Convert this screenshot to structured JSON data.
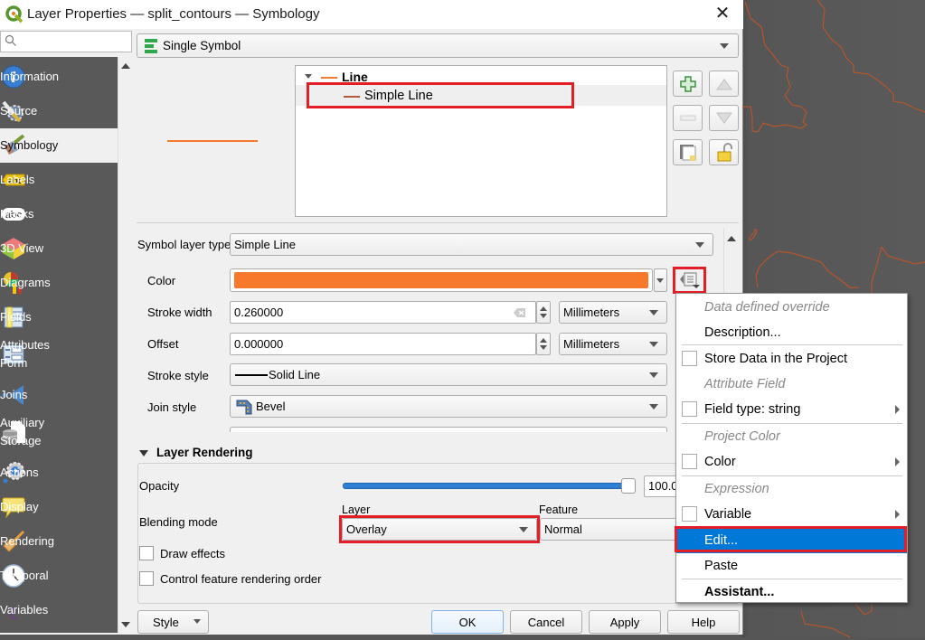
{
  "window": {
    "title": "Layer Properties — split_contours — Symbology",
    "close_icon": "close-icon"
  },
  "sidebar": {
    "search_placeholder": "",
    "items": [
      {
        "label": "Information",
        "icon": "info-icon"
      },
      {
        "label": "Source",
        "icon": "source-wrench-icon"
      },
      {
        "label": "Symbology",
        "icon": "paintbrush-icon",
        "active": true
      },
      {
        "label": "Labels",
        "icon": "labels-abc-icon"
      },
      {
        "label": "Masks",
        "icon": "masks-abc-icon"
      },
      {
        "label": "3D View",
        "icon": "cube-3d-icon"
      },
      {
        "label": "Diagrams",
        "icon": "diagrams-icon"
      },
      {
        "label": "Fields",
        "icon": "fields-table-icon"
      },
      {
        "label": "Attributes\nForm",
        "label_line1": "Attributes",
        "label_line2": "Form",
        "icon": "attributes-form-icon"
      },
      {
        "label": "Joins",
        "icon": "joins-icon"
      },
      {
        "label_line1": "Auxiliary",
        "label_line2": "Storage",
        "icon": "auxiliary-storage-icon"
      },
      {
        "label": "Actions",
        "icon": "actions-gear-icon"
      },
      {
        "label": "Display",
        "icon": "display-speech-icon"
      },
      {
        "label": "Rendering",
        "icon": "rendering-brush-icon"
      },
      {
        "label": "Temporal",
        "icon": "clock-icon"
      },
      {
        "label": "Variables",
        "icon": "epsilon-icon"
      }
    ]
  },
  "renderer": {
    "selected": "Single Symbol"
  },
  "symbol_tree": {
    "root_label": "Line",
    "child_label": "Simple Line"
  },
  "symbol_layer": {
    "type_label": "Symbol layer type",
    "type_value": "Simple Line",
    "color_label": "Color",
    "color_value": "#f7792b",
    "stroke_width_label": "Stroke width",
    "stroke_width_value": "0.260000",
    "stroke_width_unit": "Millimeters",
    "offset_label": "Offset",
    "offset_value": "0.000000",
    "offset_unit": "Millimeters",
    "stroke_style_label": "Stroke style",
    "stroke_style_value": "Solid Line",
    "join_style_label": "Join style",
    "join_style_value": "Bevel"
  },
  "layer_rendering": {
    "header": "Layer Rendering",
    "opacity_label": "Opacity",
    "opacity_value": "100.0",
    "opacity_percent": 100,
    "blending_label": "Blending mode",
    "layer_label": "Layer",
    "layer_blend": "Overlay",
    "feature_label": "Feature",
    "feature_blend": "Normal",
    "draw_effects_label": "Draw effects",
    "draw_effects_checked": false,
    "control_order_label": "Control feature rendering order",
    "control_order_checked": false
  },
  "buttons": {
    "style": "Style",
    "ok": "OK",
    "cancel": "Cancel",
    "apply": "Apply",
    "help": "Help"
  },
  "context_menu": {
    "items": [
      {
        "label": "Data defined override",
        "type": "header"
      },
      {
        "label": "Description...",
        "type": "item"
      },
      {
        "label": "Store Data in the Project",
        "type": "check",
        "checked": false
      },
      {
        "label": "Attribute Field",
        "type": "header"
      },
      {
        "label": "Field type: string",
        "type": "check-sub",
        "checked": false
      },
      {
        "label": "Project Color",
        "type": "header"
      },
      {
        "label": "Color",
        "type": "check-sub",
        "checked": false
      },
      {
        "label": "Expression",
        "type": "header"
      },
      {
        "label": "Variable",
        "type": "check-sub",
        "checked": false
      },
      {
        "label": "Edit...",
        "type": "item",
        "highlighted": true
      },
      {
        "label": "Paste",
        "type": "item"
      },
      {
        "label": "Assistant...",
        "type": "bold"
      }
    ]
  },
  "colors": {
    "accent_highlight": "#e41e26",
    "menu_selection": "#0078d7",
    "symbol_orange": "#f47a2e"
  }
}
